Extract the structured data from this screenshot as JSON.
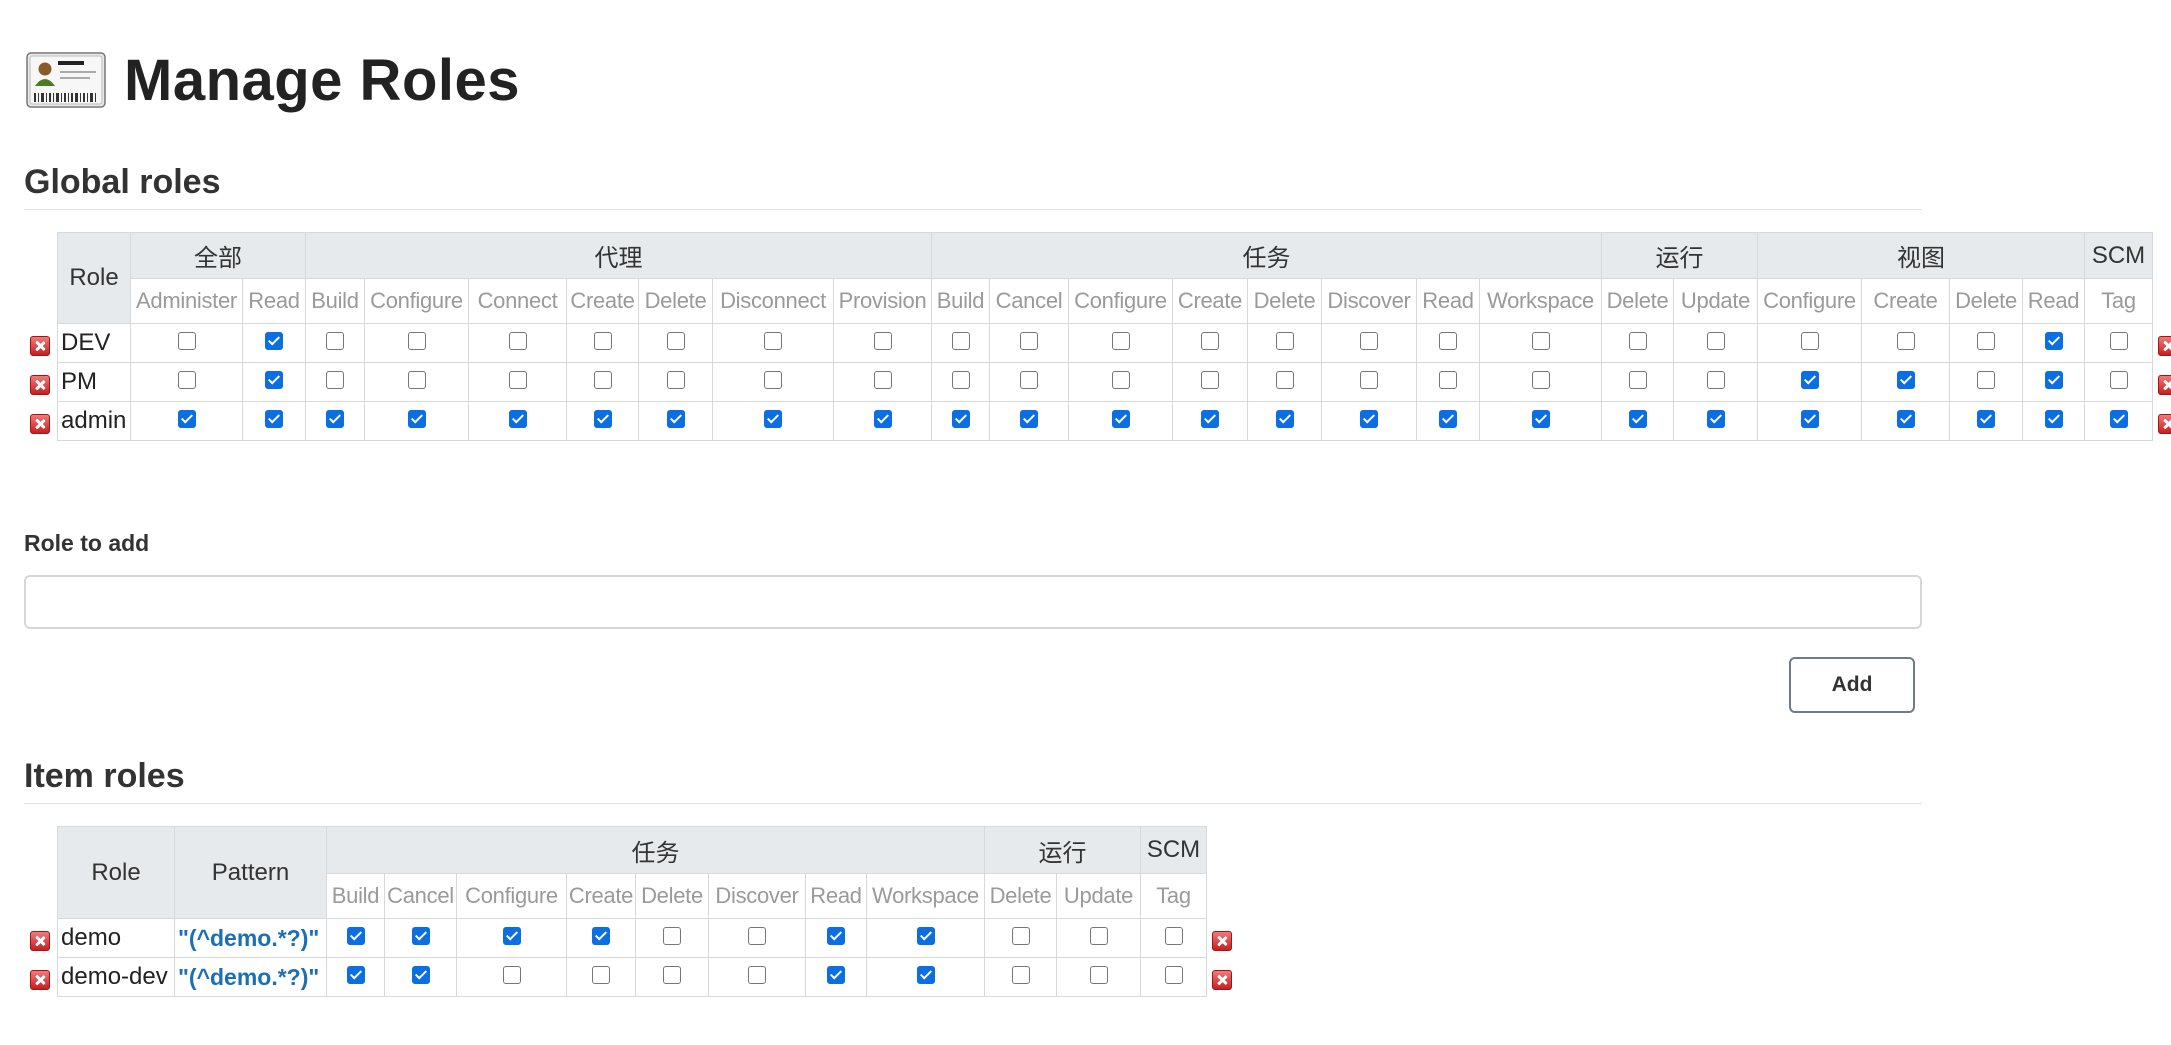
{
  "page": {
    "title": "Manage Roles",
    "header_icon": "id-card-icon"
  },
  "global_roles": {
    "title": "Global roles",
    "role_header": "Role",
    "groups": [
      {
        "label": "全部",
        "perms": [
          "Administer",
          "Read"
        ]
      },
      {
        "label": "代理",
        "perms": [
          "Build",
          "Configure",
          "Connect",
          "Create",
          "Delete",
          "Disconnect",
          "Provision"
        ]
      },
      {
        "label": "任务",
        "perms": [
          "Build",
          "Cancel",
          "Configure",
          "Create",
          "Delete",
          "Discover",
          "Read",
          "Workspace"
        ]
      },
      {
        "label": "运行",
        "perms": [
          "Delete",
          "Update"
        ]
      },
      {
        "label": "视图",
        "perms": [
          "Configure",
          "Create",
          "Delete",
          "Read"
        ]
      },
      {
        "label": "SCM",
        "perms": [
          "Tag"
        ]
      }
    ],
    "rows": [
      {
        "name": "DEV",
        "checks": [
          false,
          true,
          false,
          false,
          false,
          false,
          false,
          false,
          false,
          false,
          false,
          false,
          false,
          false,
          false,
          false,
          false,
          false,
          false,
          false,
          false,
          false,
          true,
          false
        ]
      },
      {
        "name": "PM",
        "checks": [
          false,
          true,
          false,
          false,
          false,
          false,
          false,
          false,
          false,
          false,
          false,
          false,
          false,
          false,
          false,
          false,
          false,
          false,
          false,
          true,
          true,
          false,
          true,
          false
        ]
      },
      {
        "name": "admin",
        "checks": [
          true,
          true,
          true,
          true,
          true,
          true,
          true,
          true,
          true,
          true,
          true,
          true,
          true,
          true,
          true,
          true,
          true,
          true,
          true,
          true,
          true,
          true,
          true,
          true
        ]
      }
    ]
  },
  "add_role": {
    "label": "Role to add",
    "value": "",
    "placeholder": "",
    "button_label": "Add"
  },
  "item_roles": {
    "title": "Item roles",
    "role_header": "Role",
    "pattern_header": "Pattern",
    "groups": [
      {
        "label": "任务",
        "perms": [
          "Build",
          "Cancel",
          "Configure",
          "Create",
          "Delete",
          "Discover",
          "Read",
          "Workspace"
        ]
      },
      {
        "label": "运行",
        "perms": [
          "Delete",
          "Update"
        ]
      },
      {
        "label": "SCM",
        "perms": [
          "Tag"
        ]
      }
    ],
    "rows": [
      {
        "name": "demo",
        "pattern": "\"(^demo.*?)\"",
        "checks": [
          true,
          true,
          true,
          true,
          false,
          false,
          true,
          true,
          false,
          false,
          false
        ]
      },
      {
        "name": "demo-dev",
        "pattern": "\"(^demo.*?)\"",
        "checks": [
          true,
          true,
          false,
          false,
          false,
          false,
          true,
          true,
          false,
          false,
          false
        ]
      }
    ]
  }
}
